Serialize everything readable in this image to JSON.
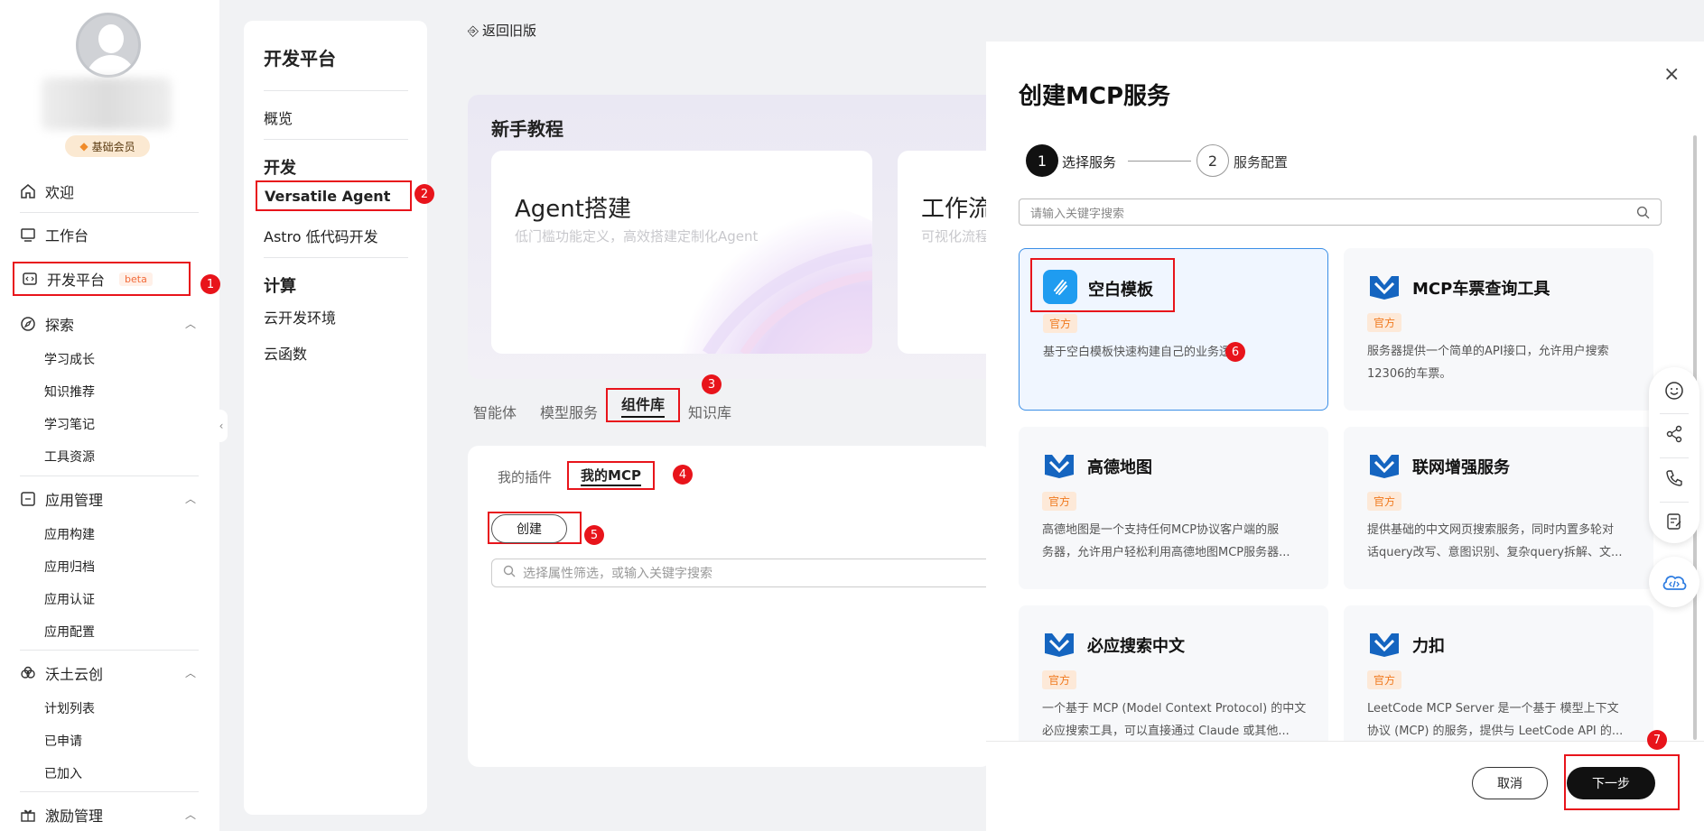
{
  "user": {
    "member_label": "基础会员"
  },
  "nav": {
    "welcome": "欢迎",
    "workbench": "工作台",
    "devplatform": "开发平台",
    "beta": "beta",
    "explore": "探索",
    "explore_items": [
      "学习成长",
      "知识推荐",
      "学习笔记",
      "工具资源"
    ],
    "appmgmt": "应用管理",
    "appmgmt_items": [
      "应用构建",
      "应用归档",
      "应用认证",
      "应用配置"
    ],
    "wotu": "沃土云创",
    "wotu_items": [
      "计划列表",
      "已申请",
      "已加入"
    ],
    "incentive": "激励管理"
  },
  "devpanel": {
    "title": "开发平台",
    "overview": "概览",
    "dev_head": "开发",
    "versatile": "Versatile Agent",
    "astro": "Astro 低代码开发",
    "compute_head": "计算",
    "cloud_env": "云开发环境",
    "cloud_func": "云函数"
  },
  "main": {
    "back": "返回旧版",
    "tutorial_title": "新手教程",
    "card1_title": "Agent搭建",
    "card1_sub": "低门槛功能定义，高效搭建定制化Agent",
    "card2_title": "工作流",
    "card2_sub": "可视化流程",
    "tabs": [
      "智能体",
      "模型服务",
      "组件库",
      "知识库"
    ],
    "subtabs": [
      "我的插件",
      "我的MCP"
    ],
    "create": "创建",
    "search_placeholder": "选择属性筛选，或输入关键字搜索"
  },
  "drawer": {
    "title": "创建MCP服务",
    "step1_num": "1",
    "step1": "选择服务",
    "step2_num": "2",
    "step2": "服务配置",
    "search_placeholder": "请输入关键字搜索",
    "services": [
      {
        "name": "空白模板",
        "tag": "官方",
        "desc1": "基于空白模板快速构建自己的业务逻辑",
        "desc2": ""
      },
      {
        "name": "MCP车票查询工具",
        "tag": "官方",
        "desc1": "服务器提供一个简单的API接口，允许用户搜索",
        "desc2": "12306的车票。"
      },
      {
        "name": "高德地图",
        "tag": "官方",
        "desc1": "高德地图是一个支持任何MCP协议客户端的服",
        "desc2": "务器，允许用户轻松利用高德地图MCP服务器..."
      },
      {
        "name": "联网增强服务",
        "tag": "官方",
        "desc1": "提供基础的中文网页搜索服务，同时内置多轮对",
        "desc2": "话query改写、意图识别、复杂query拆解、文..."
      },
      {
        "name": "必应搜索中文",
        "tag": "官方",
        "desc1": "一个基于 MCP (Model Context Protocol) 的中文",
        "desc2": "必应搜索工具，可以直接通过 Claude 或其他..."
      },
      {
        "name": "力扣",
        "tag": "官方",
        "desc1": "LeetCode MCP Server 是一个基于 模型上下文",
        "desc2": "协议 (MCP) 的服务，提供与 LeetCode API 的..."
      }
    ],
    "cancel": "取消",
    "next": "下一步"
  },
  "annotations": [
    "1",
    "2",
    "3",
    "4",
    "5",
    "6",
    "7"
  ]
}
